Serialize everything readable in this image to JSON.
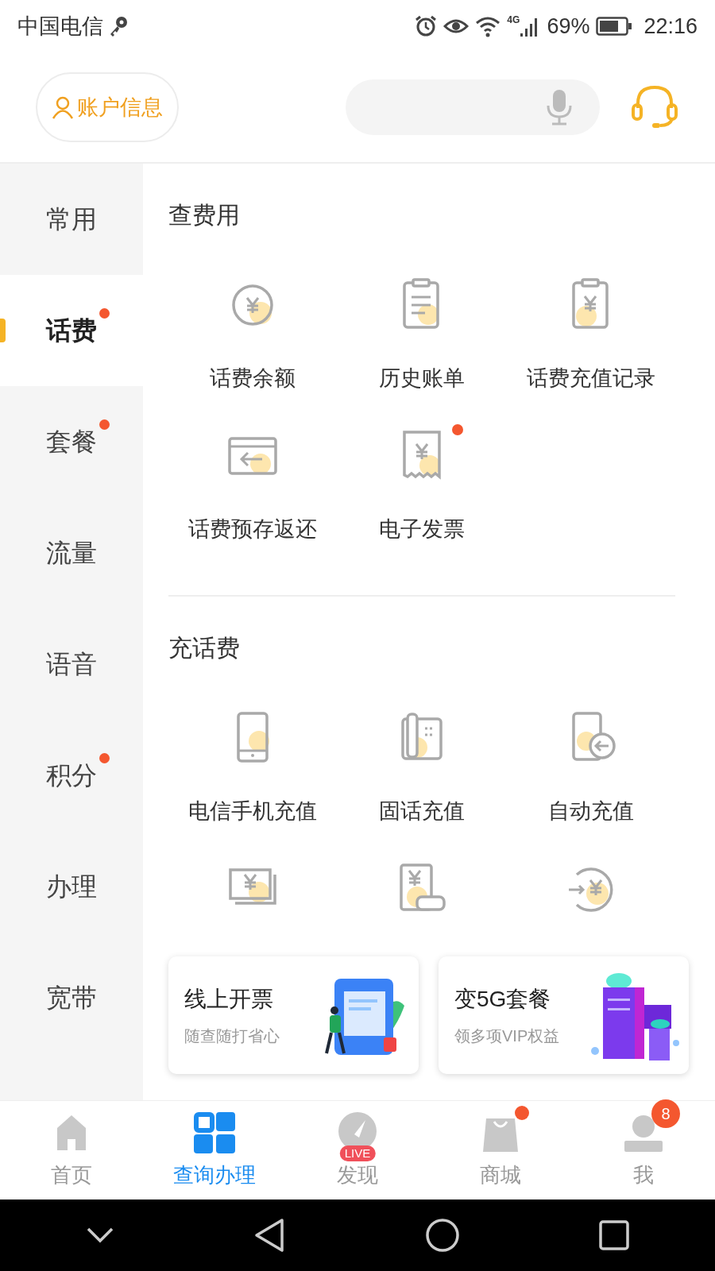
{
  "status_bar": {
    "carrier": "中国电信",
    "network": "4G",
    "battery": "69%",
    "time": "22:16"
  },
  "header": {
    "account_button": "账户信息"
  },
  "sidebar": {
    "items": [
      {
        "label": "常用",
        "selected": false
      },
      {
        "label": "话费",
        "selected": true,
        "dot": true
      },
      {
        "label": "套餐",
        "selected": false,
        "dot": true
      },
      {
        "label": "流量",
        "selected": false
      },
      {
        "label": "语音",
        "selected": false
      },
      {
        "label": "积分",
        "selected": false,
        "dot": true
      },
      {
        "label": "办理",
        "selected": false
      },
      {
        "label": "宽带",
        "selected": false
      }
    ]
  },
  "sections": [
    {
      "title": "查费用",
      "items": [
        {
          "kind": "labeled",
          "label": "话费余额"
        },
        {
          "kind": "labeled",
          "label": "历史账单"
        },
        {
          "kind": "labeled",
          "label": "话费充值记录"
        },
        {
          "kind": "labeled",
          "label": "话费预存返还"
        },
        {
          "kind": "labeled",
          "label": "电子发票",
          "dot": true
        }
      ]
    },
    {
      "title": "充话费",
      "items": [
        {
          "kind": "labeled",
          "label": "电信手机充值"
        },
        {
          "kind": "labeled",
          "label": "固话充值"
        },
        {
          "kind": "labeled",
          "label": "自动充值"
        },
        {
          "kind": "icon_only"
        },
        {
          "kind": "icon_only"
        },
        {
          "kind": "icon_only"
        }
      ]
    }
  ],
  "promo_cards": [
    {
      "title": "线上开票",
      "subtitle": "随查随打省心"
    },
    {
      "title": "变5G套餐",
      "subtitle": "领多项VIP权益"
    }
  ],
  "bottom_nav": [
    {
      "label": "首页",
      "selected": false
    },
    {
      "label": "查询办理",
      "selected": true
    },
    {
      "label": "发现",
      "selected": false,
      "tag": "LIVE"
    },
    {
      "label": "商城",
      "selected": false,
      "dot": true
    },
    {
      "label": "我",
      "selected": false,
      "badge": "8"
    }
  ]
}
